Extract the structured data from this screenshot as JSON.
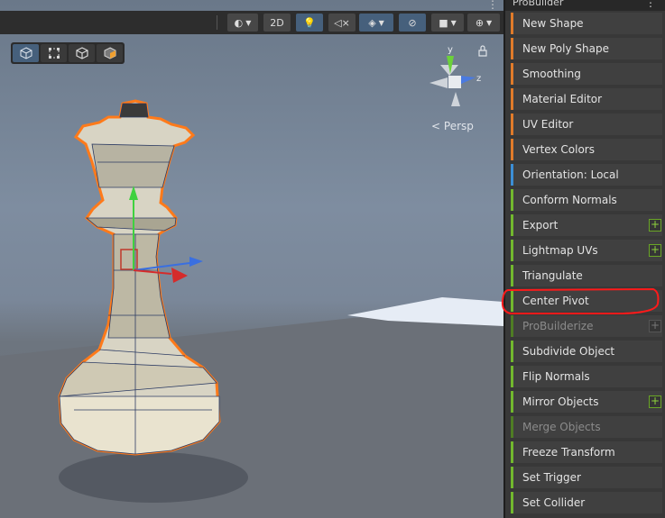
{
  "panel": {
    "title": "ProBuilder",
    "menu_glyph": "⋮",
    "items": [
      {
        "label": "New Shape",
        "color": "#e07b2a",
        "plus": false,
        "disabled": false
      },
      {
        "label": "New Poly Shape",
        "color": "#e07b2a",
        "plus": false,
        "disabled": false
      },
      {
        "label": "Smoothing",
        "color": "#e07b2a",
        "plus": false,
        "disabled": false
      },
      {
        "label": "Material Editor",
        "color": "#e07b2a",
        "plus": false,
        "disabled": false
      },
      {
        "label": "UV Editor",
        "color": "#e07b2a",
        "plus": false,
        "disabled": false
      },
      {
        "label": "Vertex Colors",
        "color": "#e07b2a",
        "plus": false,
        "disabled": false
      },
      {
        "label": "Orientation: Local",
        "color": "#3c8fd6",
        "plus": false,
        "disabled": false
      },
      {
        "label": "Conform Normals",
        "color": "#72b82e",
        "plus": false,
        "disabled": false
      },
      {
        "label": "Export",
        "color": "#72b82e",
        "plus": true,
        "disabled": false
      },
      {
        "label": "Lightmap UVs",
        "color": "#72b82e",
        "plus": true,
        "disabled": false
      },
      {
        "label": "Triangulate",
        "color": "#72b82e",
        "plus": false,
        "disabled": false
      },
      {
        "label": "Center Pivot",
        "color": "#72b82e",
        "plus": false,
        "disabled": false
      },
      {
        "label": "ProBuilderize",
        "color": "#4f7d24",
        "plus": true,
        "disabled": true
      },
      {
        "label": "Subdivide Object",
        "color": "#72b82e",
        "plus": false,
        "disabled": false
      },
      {
        "label": "Flip Normals",
        "color": "#72b82e",
        "plus": false,
        "disabled": false
      },
      {
        "label": "Mirror Objects",
        "color": "#72b82e",
        "plus": true,
        "disabled": false
      },
      {
        "label": "Merge Objects",
        "color": "#4f7d24",
        "plus": false,
        "disabled": true
      },
      {
        "label": "Freeze Transform",
        "color": "#72b82e",
        "plus": false,
        "disabled": false
      },
      {
        "label": "Set Trigger",
        "color": "#72b82e",
        "plus": false,
        "disabled": false
      },
      {
        "label": "Set Collider",
        "color": "#72b82e",
        "plus": false,
        "disabled": false
      }
    ],
    "highlight_color": "#ff1a1a",
    "plus_glyph": "+"
  },
  "toolbar": {
    "mode_2d_label": "2D",
    "scene_menu_glyph": "⋮"
  },
  "scene": {
    "view_label": "Persp",
    "gizmo_axes": {
      "y": "y",
      "z": "z"
    },
    "object_outline_color": "#ff7a1a"
  }
}
